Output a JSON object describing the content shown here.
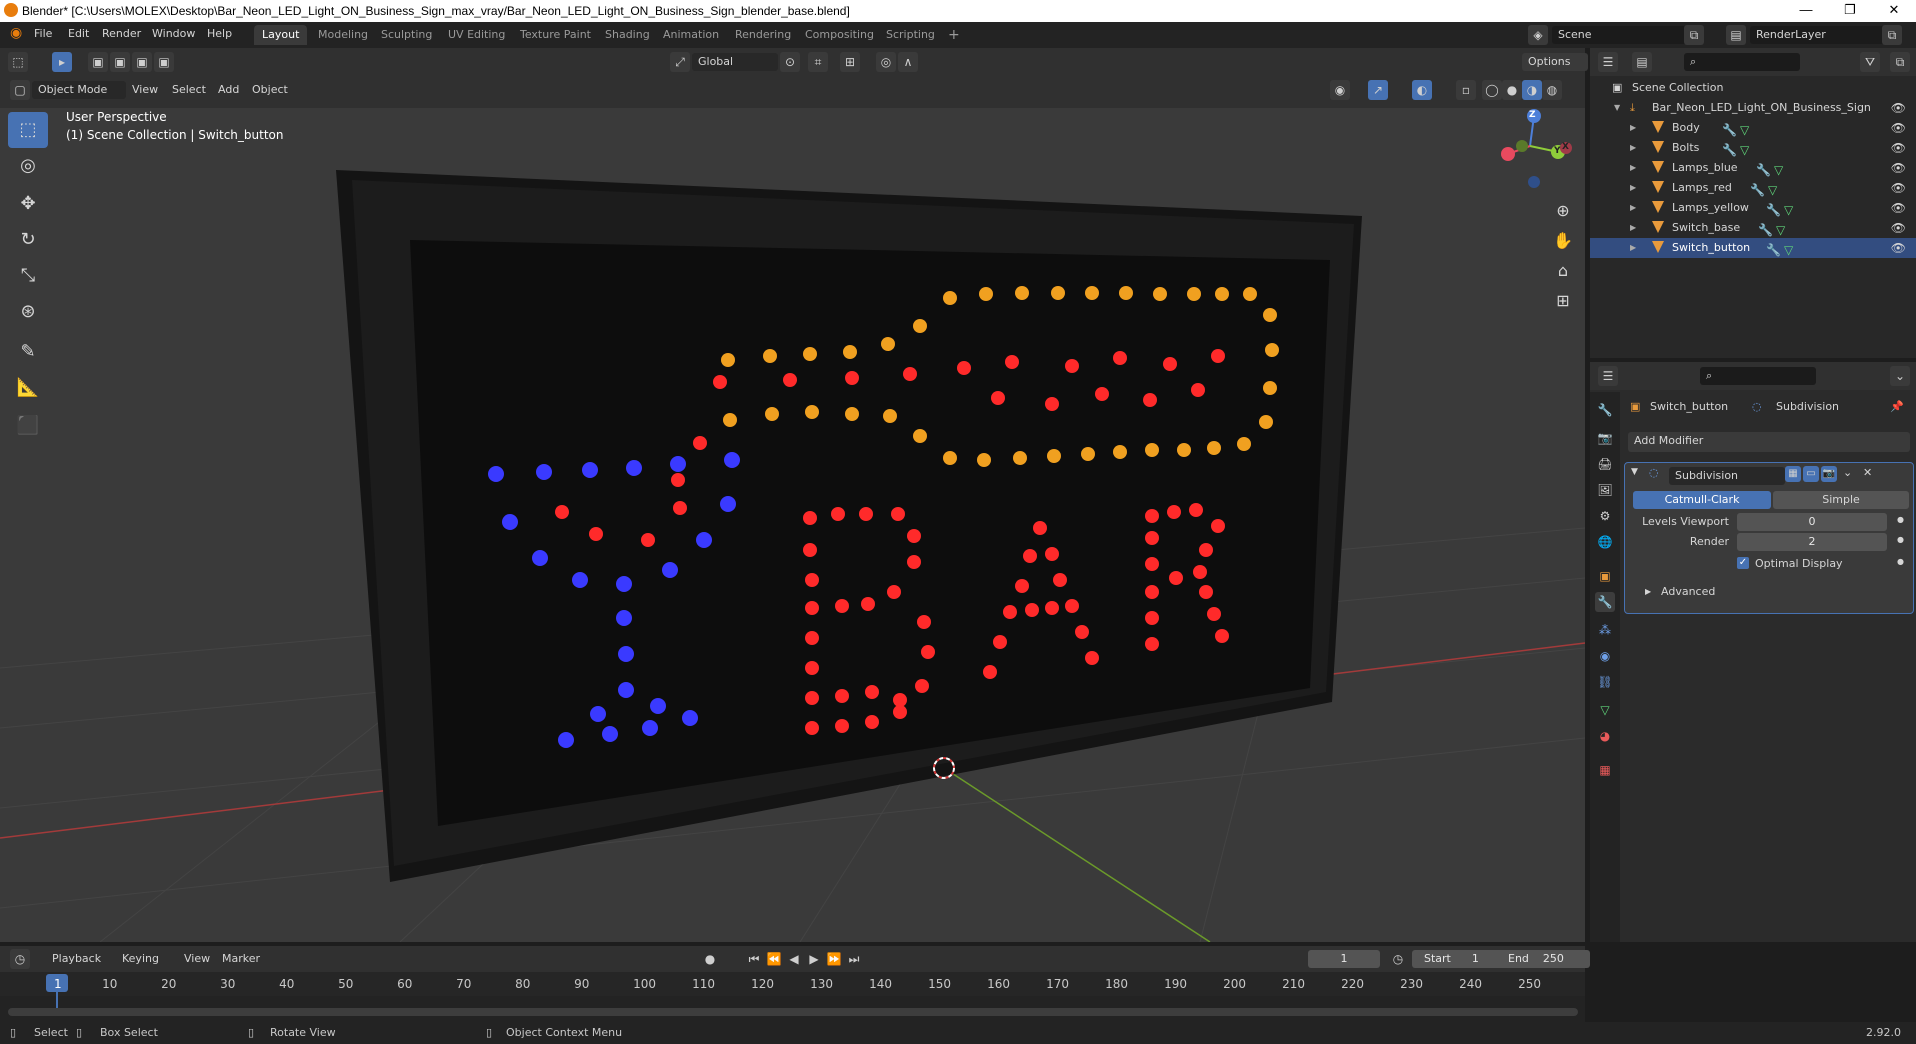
{
  "window": {
    "title": "Blender* [C:\\Users\\MOLEX\\Desktop\\Bar_Neon_LED_Light_ON_Business_Sign_max_vray/Bar_Neon_LED_Light_ON_Business_Sign_blender_base.blend]",
    "minimize": "—",
    "restore": "❐",
    "close": "✕"
  },
  "menubar": {
    "items": [
      "File",
      "Edit",
      "Render",
      "Window",
      "Help"
    ],
    "workspaces": [
      "Layout",
      "Modeling",
      "Sculpting",
      "UV Editing",
      "Texture Paint",
      "Shading",
      "Animation",
      "Rendering",
      "Compositing",
      "Scripting"
    ],
    "add_workspace": "+",
    "scene_name": "Scene",
    "render_layer": "RenderLayer"
  },
  "viewport_header": {
    "mode": "Object Mode",
    "menus": [
      "View",
      "Select",
      "Add",
      "Object"
    ],
    "transform_orientation": "Global",
    "options": "Options"
  },
  "viewport": {
    "perspective": "User Perspective",
    "context": "(1) Scene Collection | Switch_button",
    "sign_text": "BAR"
  },
  "gizmo": {
    "z": "Z",
    "y": "Y",
    "x": "X"
  },
  "outliner": {
    "root": "Scene Collection",
    "collection": "Bar_Neon_LED_Light_ON_Business_Sign",
    "objects": [
      "Body",
      "Bolts",
      "Lamps_blue",
      "Lamps_red",
      "Lamps_yellow",
      "Switch_base",
      "Switch_button"
    ]
  },
  "properties": {
    "object_name": "Switch_button",
    "modifier_crumb": "Subdivision",
    "add_modifier": "Add Modifier",
    "modifier_name": "Subdivision",
    "algorithm_options": [
      "Catmull-Clark",
      "Simple"
    ],
    "selected_algorithm": "Catmull-Clark",
    "levels_viewport_label": "Levels Viewport",
    "levels_viewport": "0",
    "render_label": "Render",
    "render_levels": "2",
    "optimal_display_label": "Optimal Display",
    "optimal_display": true,
    "advanced": "Advanced"
  },
  "timeline": {
    "menus": [
      "Playback",
      "Keying",
      "View",
      "Marker"
    ],
    "current_frame": "1",
    "start_label": "Start",
    "start": "1",
    "end_label": "End",
    "end": "250",
    "ticks": [
      "1",
      "10",
      "20",
      "30",
      "40",
      "50",
      "60",
      "70",
      "80",
      "90",
      "100",
      "110",
      "120",
      "130",
      "140",
      "150",
      "160",
      "170",
      "180",
      "190",
      "200",
      "210",
      "220",
      "230",
      "240",
      "250"
    ]
  },
  "statusbar": {
    "select": "Select",
    "box_select": "Box Select",
    "rotate_view": "Rotate View",
    "context_menu": "Object Context Menu",
    "version": "2.92.0"
  },
  "colors": {
    "accent": "#4772b3",
    "object_orange": "#e89a3c",
    "led_red": "#ff2a2a",
    "led_blue": "#3a3aff",
    "led_yellow": "#f0a020"
  }
}
